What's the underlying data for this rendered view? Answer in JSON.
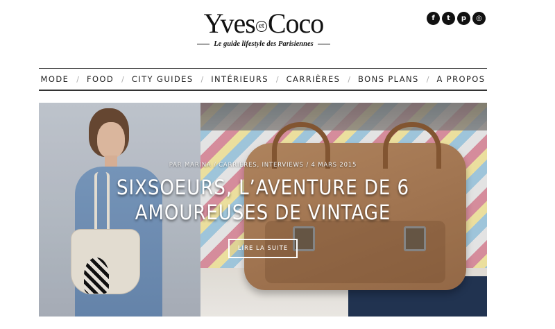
{
  "brand": {
    "logo_text_left": "Yves",
    "logo_et": "et",
    "logo_text_right": "Coco",
    "tagline": "Le guide lifestyle des Parisiennes"
  },
  "social": [
    {
      "icon": "facebook-icon",
      "glyph": "f"
    },
    {
      "icon": "twitter-icon",
      "glyph": "t"
    },
    {
      "icon": "pinterest-icon",
      "glyph": "p"
    },
    {
      "icon": "instagram-icon",
      "glyph": "◎"
    }
  ],
  "nav": {
    "items": [
      "MODE",
      "FOOD",
      "CITY GUIDES",
      "INTÉRIEURS",
      "CARRIÈRES",
      "BONS PLANS",
      "A PROPOS"
    ],
    "separator": "/"
  },
  "hero": {
    "meta": "PAR MARINA / CARRIÈRES, INTERVIEWS / 4 MARS 2015",
    "title": "SIXSOEURS, L’AVENTURE DE 6 AMOUREUSES DE VINTAGE",
    "cta_label": "LIRE LA SUITE"
  }
}
